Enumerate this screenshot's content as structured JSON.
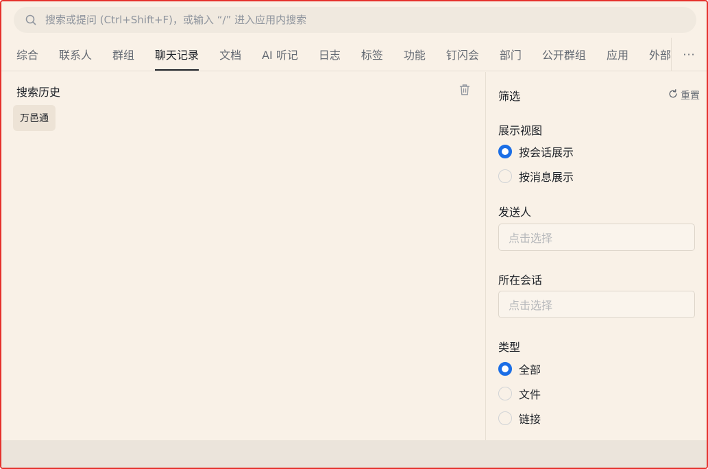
{
  "search": {
    "placeholder": "搜索或提问 (Ctrl+Shift+F)，或输入 “/” 进入应用内搜索",
    "value": ""
  },
  "tabs": [
    {
      "label": "综合",
      "active": false
    },
    {
      "label": "联系人",
      "active": false
    },
    {
      "label": "群组",
      "active": false
    },
    {
      "label": "聊天记录",
      "active": true
    },
    {
      "label": "文档",
      "active": false
    },
    {
      "label": "AI 听记",
      "active": false
    },
    {
      "label": "日志",
      "active": false
    },
    {
      "label": "标签",
      "active": false
    },
    {
      "label": "功能",
      "active": false
    },
    {
      "label": "钉闪会",
      "active": false
    },
    {
      "label": "部门",
      "active": false
    },
    {
      "label": "公开群组",
      "active": false
    },
    {
      "label": "应用",
      "active": false
    },
    {
      "label": "外部",
      "active": false
    }
  ],
  "more_label": "···",
  "history": {
    "title": "搜索历史",
    "items": [
      "万邑通"
    ]
  },
  "filter": {
    "title": "筛选",
    "reset_label": "重置",
    "view": {
      "label": "展示视图",
      "options": [
        {
          "label": "按会话展示",
          "checked": true
        },
        {
          "label": "按消息展示",
          "checked": false
        }
      ]
    },
    "sender": {
      "label": "发送人",
      "placeholder": "点击选择"
    },
    "conversation": {
      "label": "所在会话",
      "placeholder": "点击选择"
    },
    "type": {
      "label": "类型",
      "options": [
        {
          "label": "全部",
          "checked": true
        },
        {
          "label": "文件",
          "checked": false
        },
        {
          "label": "链接",
          "checked": false
        }
      ]
    }
  },
  "colors": {
    "accent": "#1b6ee6",
    "background": "#f9f1e7",
    "frame_border": "#e5312c"
  }
}
